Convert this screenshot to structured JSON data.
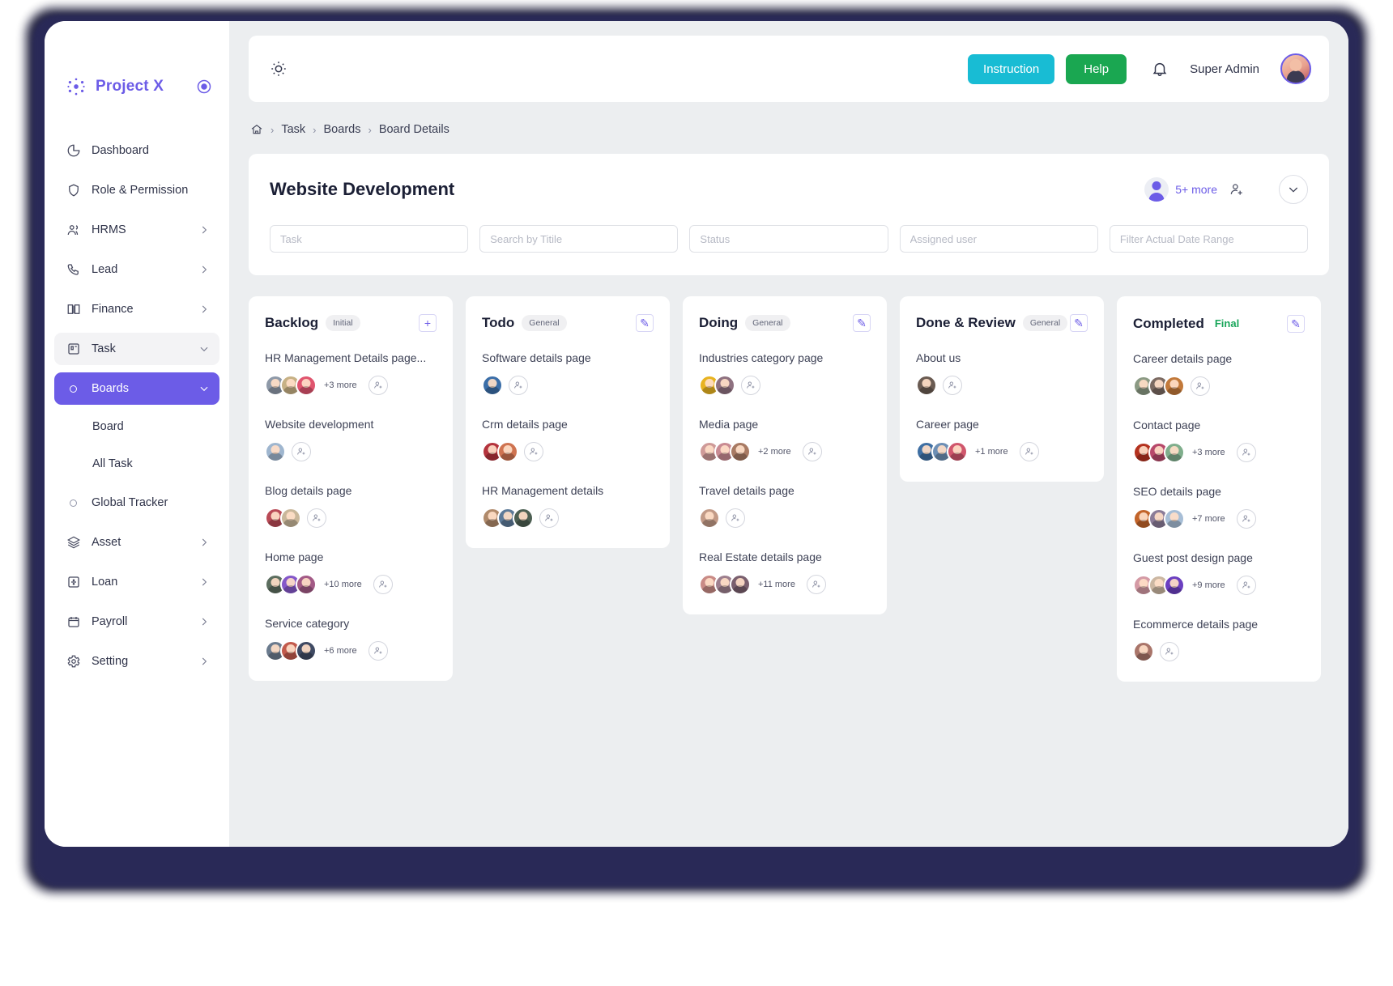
{
  "brand": {
    "name": "Project X"
  },
  "sidebar": {
    "items": [
      {
        "label": "Dashboard",
        "icon": "pie-chart-icon",
        "chevron": false
      },
      {
        "label": "Role & Permission",
        "icon": "shield-icon",
        "chevron": false
      },
      {
        "label": "HRMS",
        "icon": "users-icon",
        "chevron": true
      },
      {
        "label": "Lead",
        "icon": "phone-icon",
        "chevron": true
      },
      {
        "label": "Finance",
        "icon": "book-icon",
        "chevron": true
      },
      {
        "label": "Task",
        "icon": "task-icon",
        "chevron": true,
        "state": "soft"
      },
      {
        "label": "Boards",
        "icon": "circle-icon",
        "chevron": true,
        "state": "strong"
      },
      {
        "label": "Board",
        "icon": "",
        "sub": true
      },
      {
        "label": "All Task",
        "icon": "",
        "sub": true
      },
      {
        "label": "Global Tracker",
        "icon": "circle-icon",
        "chevron": false
      },
      {
        "label": "Asset",
        "icon": "layers-icon",
        "chevron": true
      },
      {
        "label": "Loan",
        "icon": "loan-icon",
        "chevron": true
      },
      {
        "label": "Payroll",
        "icon": "calendar-icon",
        "chevron": true
      },
      {
        "label": "Setting",
        "icon": "gear-icon",
        "chevron": true
      }
    ]
  },
  "topbar": {
    "theme_icon": "sun-icon",
    "instruction_label": "Instruction",
    "help_label": "Help",
    "bell_icon": "bell-icon",
    "user_name": "Super Admin"
  },
  "breadcrumb": {
    "home_icon": "home-icon",
    "items": [
      "Task",
      "Boards",
      "Board Details"
    ]
  },
  "board": {
    "title": "Website Development",
    "members_more": "5+ more",
    "add_user_icon": "add-user-icon",
    "expand_icon": "chevron-down-icon",
    "filters": [
      {
        "placeholder": "Task",
        "value": ""
      },
      {
        "placeholder": "Search by Titile",
        "value": ""
      },
      {
        "placeholder": "Status",
        "value": ""
      },
      {
        "placeholder": "Assigned user",
        "value": ""
      },
      {
        "placeholder": "Filter Actual Date Range",
        "value": ""
      }
    ]
  },
  "colors": {
    "accent": "#6c5ce7",
    "instruction": "#18bcd4",
    "help": "#1aa751",
    "final_badge": "#19a65a",
    "canvas": "#eceef0"
  },
  "columns": [
    {
      "title": "Backlog",
      "badge": "Initial",
      "badge_style": "gray",
      "action_icon": "plus-icon",
      "action_glyph": "+",
      "tasks": [
        {
          "title": "HR Management Details page...",
          "avatars": [
            "#8e99a8",
            "#c7b185",
            "#e0556f"
          ],
          "more": "+3 more"
        },
        {
          "title": "Website development",
          "avatars": [
            "#9fb6cf"
          ],
          "more": ""
        },
        {
          "title": "Blog details page",
          "avatars": [
            "#b94a56",
            "#c9b79a"
          ],
          "more": ""
        },
        {
          "title": "Home page",
          "avatars": [
            "#5c6e5f",
            "#8457c9",
            "#a35a86"
          ],
          "more": "+10 more"
        },
        {
          "title": "Service category",
          "avatars": [
            "#6b7b8e",
            "#c25a4c",
            "#3f4a63"
          ],
          "more": "+6 more"
        }
      ]
    },
    {
      "title": "Todo",
      "badge": "General",
      "badge_style": "gray",
      "action_icon": "edit-icon",
      "action_glyph": "✎",
      "tasks": [
        {
          "title": "Software details page",
          "avatars": [
            "#3b6ea8"
          ],
          "more": ""
        },
        {
          "title": "Crm details page",
          "avatars": [
            "#b4333d",
            "#cf7350"
          ],
          "more": ""
        },
        {
          "title": "HR Management details",
          "avatars": [
            "#b08a6b",
            "#5d7a98",
            "#4c5f52"
          ],
          "more": ""
        }
      ]
    },
    {
      "title": "Doing",
      "badge": "General",
      "badge_style": "gray",
      "action_icon": "edit-icon",
      "action_glyph": "✎",
      "tasks": [
        {
          "title": "Industries category page",
          "avatars": [
            "#e8b320",
            "#8e7180"
          ],
          "more": ""
        },
        {
          "title": "Media page",
          "avatars": [
            "#cf9a98",
            "#c98b93",
            "#a87a63"
          ],
          "more": "+2 more"
        },
        {
          "title": "Travel details page",
          "avatars": [
            "#c29a86"
          ],
          "more": ""
        },
        {
          "title": "Real Estate details page",
          "avatars": [
            "#c98b86",
            "#9d7f8e",
            "#7a5f6e"
          ],
          "more": "+11 more"
        }
      ]
    },
    {
      "title": "Done & Review",
      "badge": "General",
      "badge_style": "gray",
      "action_icon": "edit-icon",
      "action_glyph": "✎",
      "tasks": [
        {
          "title": "About us",
          "avatars": [
            "#6a5b52"
          ],
          "more": ""
        },
        {
          "title": "Career page",
          "avatars": [
            "#3f6fa3",
            "#6d8fb5",
            "#d0566c"
          ],
          "more": "+1 more"
        }
      ]
    },
    {
      "title": "Completed",
      "badge": "Final",
      "badge_style": "final",
      "action_icon": "edit-icon",
      "action_glyph": "✎",
      "tasks": [
        {
          "title": "Career details page",
          "avatars": [
            "#8b9a84",
            "#7b6a62",
            "#c2793a"
          ],
          "more": ""
        },
        {
          "title": "Contact page",
          "avatars": [
            "#b4321f",
            "#b7486a",
            "#7fae8c"
          ],
          "more": "+3 more"
        },
        {
          "title": "SEO details page",
          "avatars": [
            "#c2642a",
            "#8b7c98",
            "#a7bed6"
          ],
          "more": "+7 more"
        },
        {
          "title": "Guest post design page",
          "avatars": [
            "#d49aa5",
            "#cbb7a2",
            "#6b3fc0"
          ],
          "more": "+9 more"
        },
        {
          "title": "Ecommerce details page",
          "avatars": [
            "#a9756a"
          ],
          "more": ""
        }
      ]
    }
  ]
}
